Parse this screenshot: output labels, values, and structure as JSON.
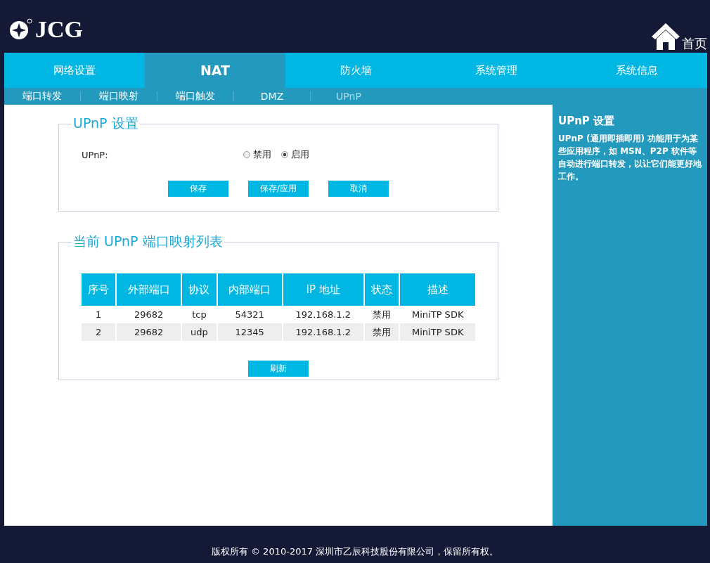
{
  "header": {
    "logo": "JCG",
    "home_link": "首页"
  },
  "main_tabs": [
    {
      "label": "网络设置",
      "selected": false
    },
    {
      "label": "NAT",
      "selected": true
    },
    {
      "label": "防火墙",
      "selected": false
    },
    {
      "label": "系统管理",
      "selected": false
    },
    {
      "label": "系统信息",
      "selected": false
    }
  ],
  "sub_tabs": [
    {
      "label": "端口转发",
      "selected": false
    },
    {
      "label": "端口映射",
      "selected": false
    },
    {
      "label": "端口触发",
      "selected": false
    },
    {
      "label": "DMZ",
      "selected": false
    },
    {
      "label": "UPnP",
      "selected": true
    }
  ],
  "upnp_settings": {
    "title": "UPnP 设置",
    "label": "UPnP:",
    "options": [
      {
        "label": "禁用",
        "selected": false
      },
      {
        "label": "启用",
        "selected": true
      }
    ],
    "buttons": [
      "保存",
      "保存/应用",
      "取消"
    ]
  },
  "mapping_list": {
    "title": "当前 UPnP 端口映射列表",
    "columns": [
      "序号",
      "外部端口",
      "协议",
      "内部端口",
      "IP 地址",
      "状态",
      "描述"
    ],
    "rows": [
      [
        "1",
        "29682",
        "tcp",
        "54321",
        "192.168.1.2",
        "禁用",
        "MiniTP SDK"
      ],
      [
        "2",
        "29682",
        "udp",
        "12345",
        "192.168.1.2",
        "禁用",
        "MiniTP SDK"
      ]
    ],
    "refresh_button": "刷新"
  },
  "help": {
    "title": "UPnP 设置",
    "text": "UPnP (通用即插即用) 功能用于为某些应用程序，如 MSN、P2P 软件等自动进行端口转发，以让它们能更好地工作。"
  },
  "footer": "版权所有 © 2010-2017 深圳市乙辰科技股份有限公司，保留所有权。"
}
